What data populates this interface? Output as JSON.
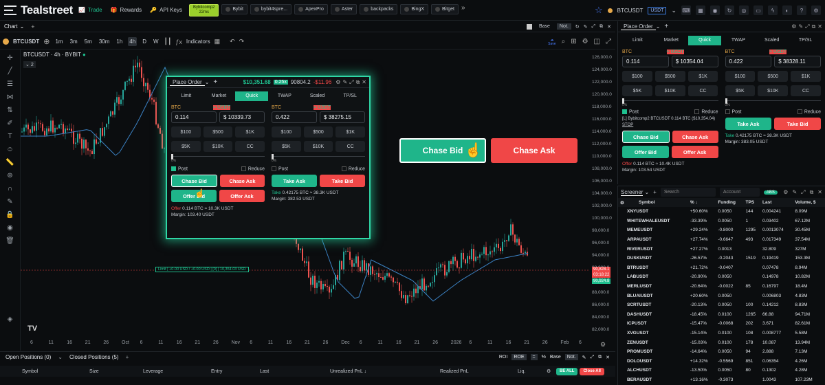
{
  "app": {
    "brand": "Tealstreet"
  },
  "nav": [
    {
      "label": "Trade",
      "active": true
    },
    {
      "label": "Rewards"
    },
    {
      "label": "API Keys"
    }
  ],
  "exchanges": [
    {
      "name": "Bybitcomp2",
      "sub": "22ms",
      "active": true
    },
    {
      "name": "Bybit"
    },
    {
      "name": "bybit4spre..."
    },
    {
      "name": "ApexPro"
    },
    {
      "name": "Aster"
    },
    {
      "name": "backpacks"
    },
    {
      "name": "BingX"
    },
    {
      "name": "Bitget"
    }
  ],
  "top_right": {
    "symbol": "BTCUSDT",
    "quote": "USDT"
  },
  "chart_header": {
    "tab": "Chart",
    "base": "Base",
    "not": "Not."
  },
  "toolbar": {
    "symbol": "BTCUSDT",
    "timeframes": [
      "1m",
      "3m",
      "5m",
      "30m",
      "1h",
      "4h",
      "D",
      "W"
    ],
    "selected": "4h",
    "indicators": "Indicators",
    "save": "Save"
  },
  "legend": {
    "title": "BTCUSDT · 4h · BYBIT",
    "count": "2"
  },
  "price_levels": [
    "126,000.0",
    "124,000.0",
    "122,000.0",
    "120,000.0",
    "118,000.0",
    "116,000.0",
    "114,000.0",
    "112,000.0",
    "110,000.0",
    "108,000.0",
    "106,000.0",
    "104,000.0",
    "102,000.0",
    "100,000.0",
    "98,000.0",
    "96,000.0",
    "94,000.0",
    "92,000.0",
    "90,000.0",
    "88,000.0",
    "86,000.0",
    "84,000.0",
    "82,000.0"
  ],
  "price_tags": [
    "90,828.1",
    "03:18:22",
    "90,924.8"
  ],
  "order_line": "Limit | +0.00 USD / +0.00 USD | [0] | 10,354.03 USD",
  "time_labels": [
    "6",
    "11",
    "16",
    "21",
    "26",
    "Oct",
    "6",
    "11",
    "16",
    "21",
    "26",
    "Nov",
    "6",
    "11",
    "16",
    "21",
    "26",
    "Dec",
    "6",
    "11",
    "16",
    "21",
    "26",
    "2026",
    "6",
    "11",
    "16",
    "21",
    "26",
    "Feb",
    "6"
  ],
  "bottom": {
    "tabs": [
      "Open Positions (0)",
      "Closed Positions (5)"
    ],
    "roi": "ROI",
    "roe": "ROE",
    "eq": "=",
    "pct": "%",
    "base": "Base",
    "not": "Not.",
    "columns": [
      "Symbol",
      "Size",
      "Leverage",
      "Entry",
      "Last",
      "Unrealized PnL ↓",
      "Realized PnL",
      "Liq."
    ],
    "be_all": "BE ALL",
    "close_all": "Close All"
  },
  "place_order": {
    "title": "Place Order",
    "stats": {
      "balance": "$10,351.68",
      "lev": "0.25x",
      "ask": "90804.2",
      "pnl": "-$11.96"
    },
    "tabs": [
      "Limit",
      "Market",
      "Quick",
      "TWAP",
      "Scaled",
      "TP/SL"
    ],
    "active_tab": "Quick",
    "left": {
      "btc_label": "BTC",
      "usdt_label": "≈ USDT",
      "btc": "0.114",
      "usdt": "$ 10339.73",
      "quick": [
        "$100",
        "$500",
        "$1K",
        "$5K",
        "$10K",
        "CC"
      ],
      "slider": "0%",
      "post": "Post",
      "reduce": "Reduce",
      "b1": "Chase Bid",
      "b2": "Chase Ask",
      "b3": "Offer Bid",
      "b4": "Offer Ask",
      "offer_line": "0.114 BTC ≈ 10.3K USDT",
      "offer_word": "Offer",
      "margin": "Margin: 103.40 USDT"
    },
    "right": {
      "btc_label": "BTC",
      "usdt_label": "≈ USDT",
      "btc": "0.422",
      "usdt": "$ 38275.15",
      "quick": [
        "$100",
        "$500",
        "$1K",
        "$5K",
        "$10K",
        "CC"
      ],
      "slider": "0%",
      "post": "Post",
      "reduce": "Reduce",
      "b1": "Take Ask",
      "b2": "Take Bid",
      "take_line": "0.42175 BTC ≈ 38.3K USDT",
      "take_word": "Take",
      "margin": "Margin: 382.53 USDT"
    }
  },
  "big_buttons": {
    "bid": "Chase Bid",
    "ask": "Chase Ask"
  },
  "right_panel": {
    "title": "Place Order",
    "tabs": [
      "Limit",
      "Market",
      "Quick",
      "TWAP",
      "Scaled",
      "TP/SL"
    ],
    "left": {
      "btc": "0.114",
      "usdt": "$ 10354.04",
      "quick": [
        "$100",
        "$500",
        "$1K",
        "$5K",
        "$10K",
        "CC"
      ],
      "slider": "0%",
      "post": "Post",
      "reduce": "Reduce",
      "info": "[L] Bybitcomp2 BTCUSDT 0.114 BTC ($10,354.04)",
      "stop": "STOP",
      "b1": "Chase Bid",
      "b2": "Chase Ask",
      "b3": "Offer Bid",
      "b4": "Offer Ask",
      "offer_line": "0.114 BTC ≈ 10.4K USDT",
      "offer_word": "Offer",
      "margin": "Margin: 103.54 USDT"
    },
    "right": {
      "btc": "0.422",
      "usdt": "$ 38328.11",
      "quick": [
        "$100",
        "$500",
        "$1K",
        "$5K",
        "$10K",
        "CC"
      ],
      "slider": "0%",
      "post": "Post",
      "reduce": "Reduce",
      "b1": "Take Ask",
      "b2": "Take Bid",
      "take_line": "0.42175 BTC ≈ 38.3K USDT",
      "take_word": "Take",
      "margin": "Margin: 383.05 USDT"
    }
  },
  "screener": {
    "title": "Screener",
    "search": "Search",
    "account": "Account",
    "abs": "ABS",
    "columns": [
      "Symbol",
      "% ↓",
      "Funding",
      "TPS",
      "Last",
      "Volume, $"
    ],
    "rows": [
      [
        "XNYUSDT",
        "+50.60%",
        "0.0050",
        "144",
        "0.004241",
        "8.09M"
      ],
      [
        "WHITEWHALEUSDT",
        "-33.39%",
        "0.0050",
        "1",
        "0.03402",
        "67.12M"
      ],
      [
        "MEMEUSDT",
        "+29.24%",
        "-0.8000",
        "1295",
        "0.0013074",
        "30.45M"
      ],
      [
        "ARPAUSDT",
        "+27.74%",
        "-0.6647",
        "493",
        "0.017349",
        "37.54M"
      ],
      [
        "RIVERUSDT",
        "+27.27%",
        "0.0013",
        "",
        "32.809",
        "327M"
      ],
      [
        "DUSKUSDT",
        "-26.57%",
        "-0.2043",
        "1519",
        "0.19419",
        "153.3M"
      ],
      [
        "BTRUSDT",
        "+21.72%",
        "-0.0407",
        "",
        "0.07478",
        "8.94M"
      ],
      [
        "LABUSDT",
        "-20.90%",
        "0.0050",
        "",
        "0.14978",
        "10.82M"
      ],
      [
        "MERLUSDT",
        "-20.64%",
        "-0.0022",
        "85",
        "0.16797",
        "18.4M"
      ],
      [
        "BLUAIUSDT",
        "+20.60%",
        "0.0050",
        "",
        "0.006803",
        "4.83M"
      ],
      [
        "SCRTUSDT",
        "-20.13%",
        "0.0050",
        "100",
        "0.14212",
        "8.83M"
      ],
      [
        "DASHUSDT",
        "-18.45%",
        "0.0100",
        "1265",
        "66.88",
        "94.71M"
      ],
      [
        "ICPUSDT",
        "-15.47%",
        "-0.0068",
        "202",
        "3.671",
        "82.61M"
      ],
      [
        "XVGUSDT",
        "-15.14%",
        "0.0100",
        "108",
        "0.008777",
        "5.58M"
      ],
      [
        "ZENUSDT",
        "-15.03%",
        "0.0100",
        "178",
        "10.087",
        "13.94M"
      ],
      [
        "PROMUSDT",
        "-14.64%",
        "0.0050",
        "94",
        "2.888",
        "7.13M"
      ],
      [
        "DOLOUSDT",
        "+14.32%",
        "-0.5569",
        "851",
        "0.06354",
        "4.26M"
      ],
      [
        "ALCHUSDT",
        "-13.50%",
        "0.0050",
        "80",
        "0.1302",
        "4.28M"
      ],
      [
        "BERAUSDT",
        "+13.16%",
        "-0.3073",
        "",
        "1.0043",
        "107.23M"
      ]
    ]
  }
}
